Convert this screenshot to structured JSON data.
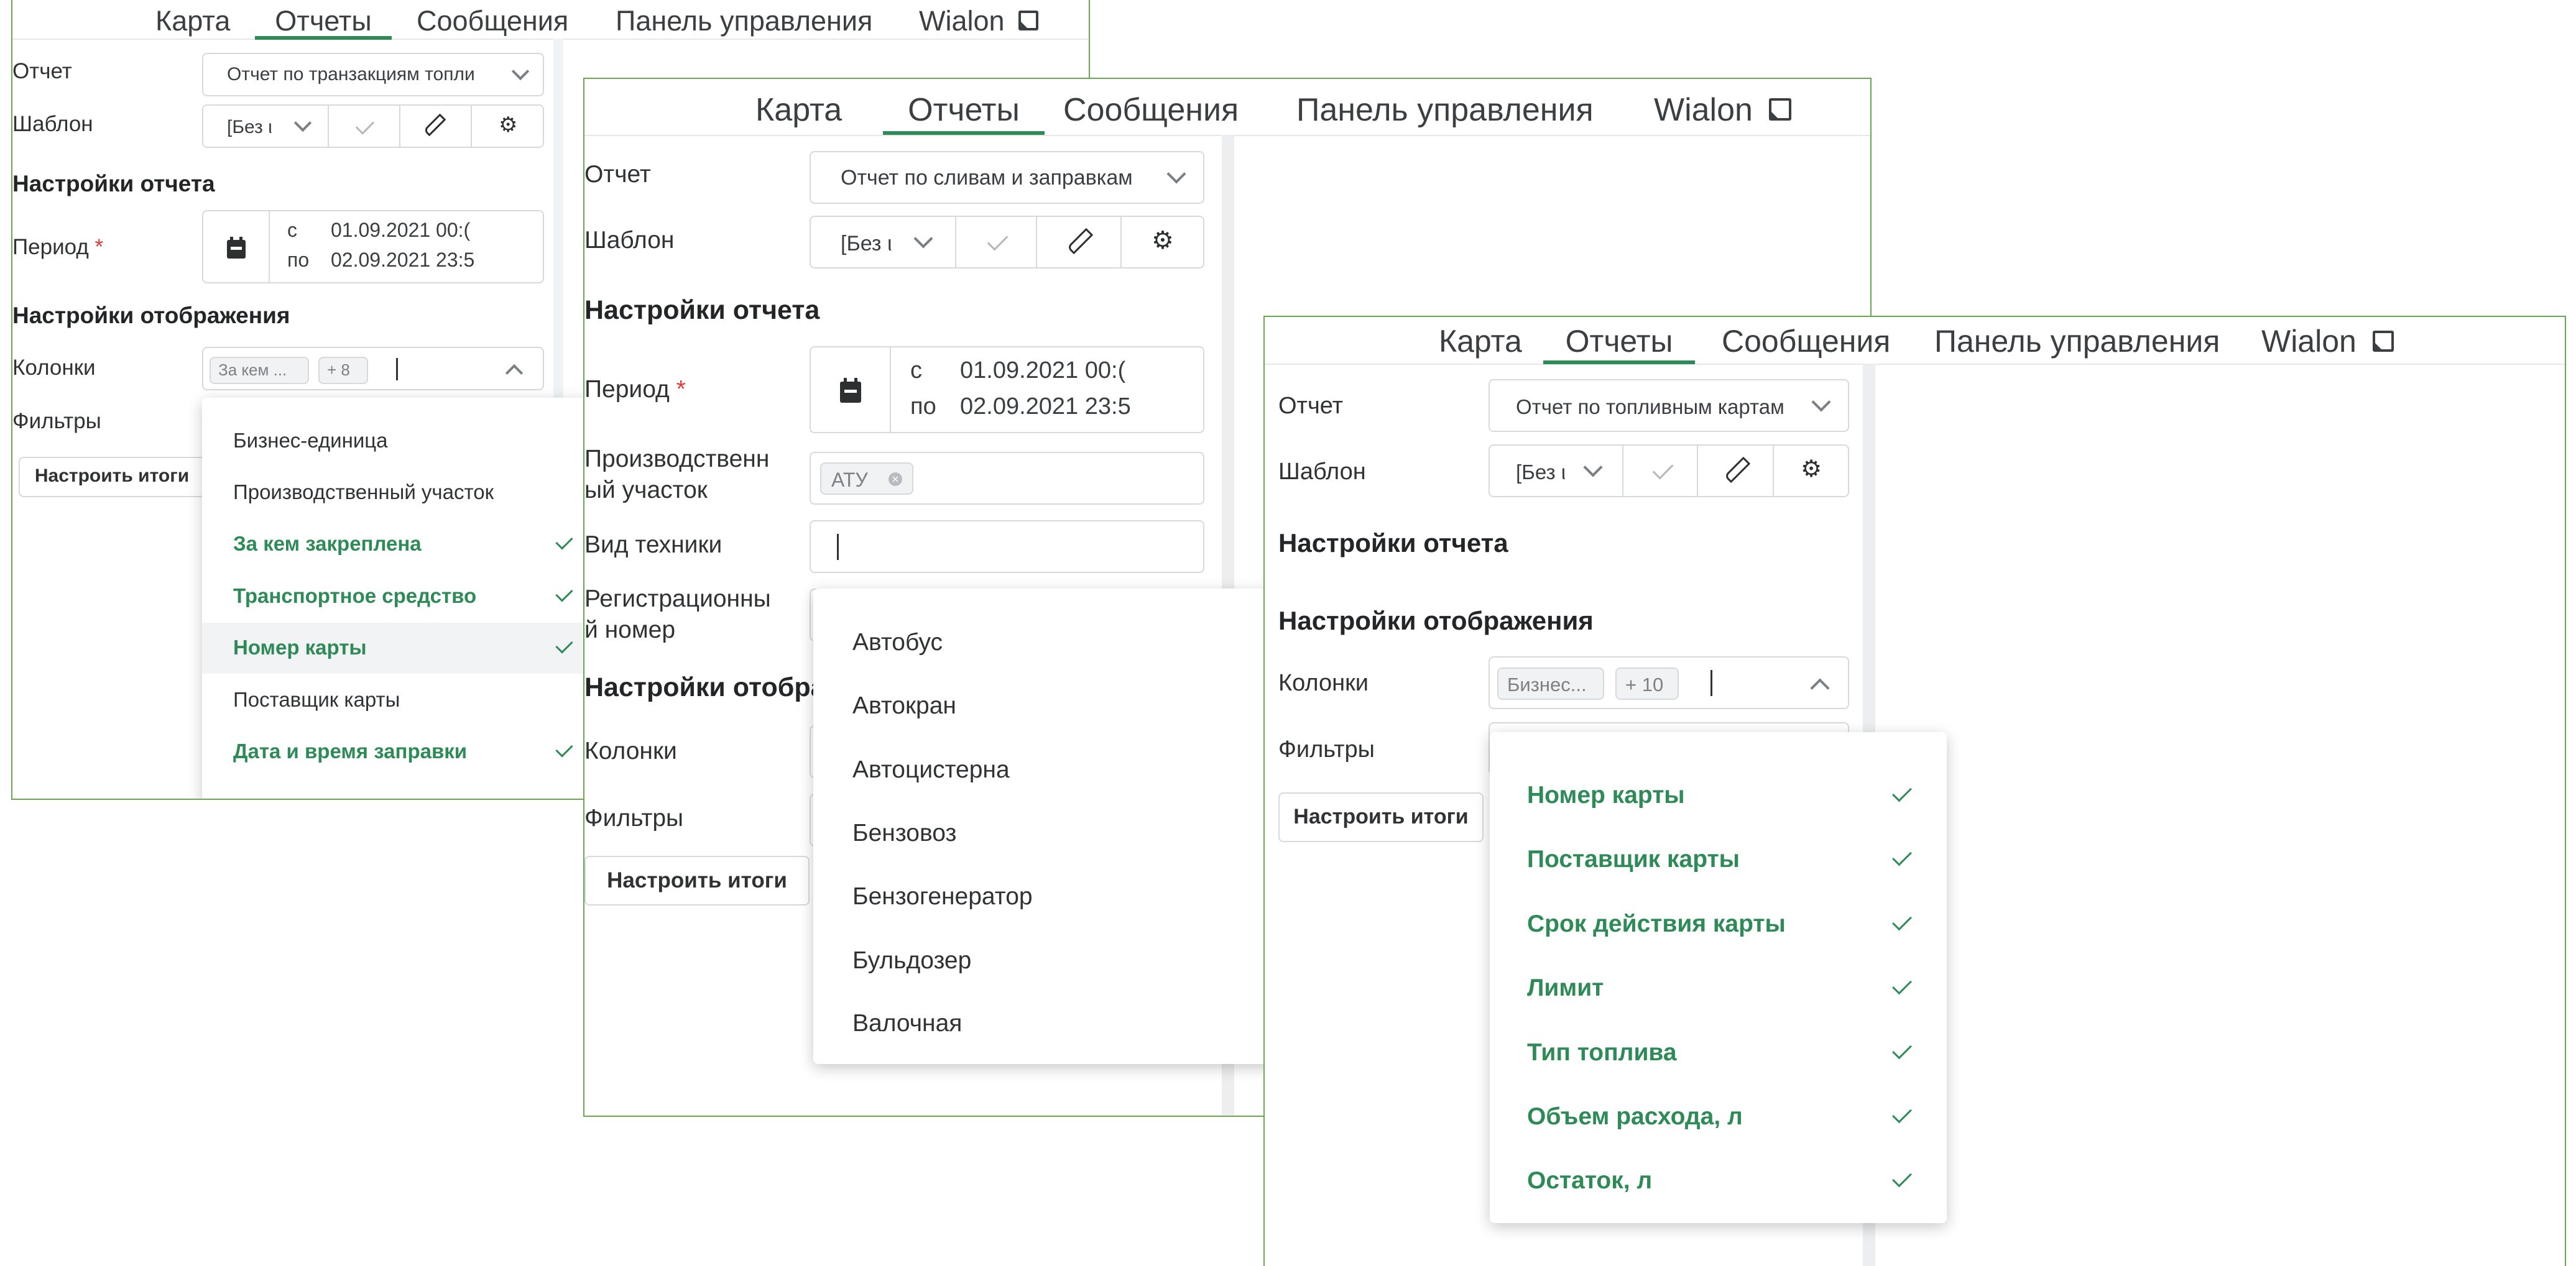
{
  "colors": {
    "accent": "#2e8b57",
    "panel_border": "#6aa84f",
    "required": "#e53935"
  },
  "nav": {
    "map": "Карта",
    "reports": "Отчеты",
    "messages": "Сообщения",
    "dashboard": "Панель управления",
    "wialon": "Wialon"
  },
  "labels": {
    "report": "Отчет",
    "template": "Шаблон",
    "report_settings": "Настройки отчета",
    "period": "Период",
    "display_settings": "Настройки отображения",
    "display_settings_cut": "Настройки отобра",
    "columns": "Колонки",
    "filters": "Фильтры",
    "required_mark": "*",
    "production_site_1": "Производственн",
    "production_site_2": "ый участок",
    "equipment_type": "Вид техники",
    "reg_number_1": "Регистрационны",
    "reg_number_2": "й номер",
    "setup_totals": "Настроить итоги",
    "period_from": "с",
    "period_to": "по",
    "date_from": "01.09.2021 00:(",
    "date_to": "02.09.2021 23:5"
  },
  "panel1": {
    "report_value": "Отчет по транзакциям топли",
    "template_value": "[Без ι",
    "columns_tag": "За кем ...",
    "columns_more": "+ 8",
    "dropdown": [
      {
        "label": "Бизнес-единица",
        "selected": false
      },
      {
        "label": "Производственный участок",
        "selected": false
      },
      {
        "label": "За кем закреплена",
        "selected": true
      },
      {
        "label": "Транспортное средство",
        "selected": true
      },
      {
        "label": "Номер карты",
        "selected": true
      },
      {
        "label": "Поставщик карты",
        "selected": false
      },
      {
        "label": "Дата и время заправки",
        "selected": true
      }
    ]
  },
  "panel2": {
    "report_value": "Отчет по сливам и заправкам",
    "template_value": "[Без ι",
    "production_site_tag": "АТУ",
    "equipment_options": [
      "Автобус",
      "Автокран",
      "Автоцистерна",
      "Бензовоз",
      "Бензогенератор",
      "Бульдозер",
      "Валочная"
    ]
  },
  "panel3": {
    "report_value": "Отчет по топливным картам",
    "template_value": "[Без ι",
    "columns_tag": "Бизнес...",
    "columns_more": "+ 10",
    "dropdown": [
      {
        "label": "Номер карты",
        "selected": true
      },
      {
        "label": "Поставщик карты",
        "selected": true
      },
      {
        "label": "Срок действия карты",
        "selected": true
      },
      {
        "label": "Лимит",
        "selected": true
      },
      {
        "label": "Тип топлива",
        "selected": true
      },
      {
        "label": "Объем расхода, л",
        "selected": true
      },
      {
        "label": "Остаток, л",
        "selected": true
      }
    ]
  }
}
